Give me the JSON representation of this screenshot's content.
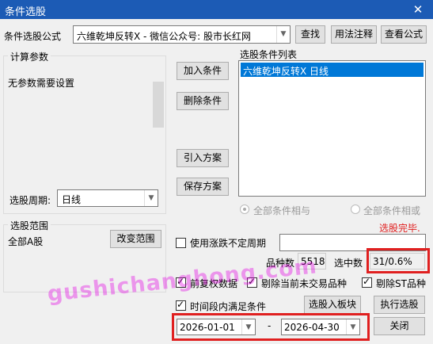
{
  "window": {
    "title": "条件选股",
    "close_glyph": "✕"
  },
  "formula": {
    "label": "条件选股公式",
    "value": "六维乾坤反转X  -  微信公众号: 股市长红网",
    "dropdown_glyph": "▼",
    "find_label": "查找",
    "usage_label": "用法注释",
    "view_label": "查看公式"
  },
  "params": {
    "legend": "计算参数",
    "text": "无参数需要设置"
  },
  "period": {
    "label": "选股周期:",
    "value": "日线",
    "dropdown_glyph": "▼"
  },
  "buttons": {
    "add": "加入条件",
    "delete": "删除条件",
    "import": "引入方案",
    "save": "保存方案",
    "change_range": "改变范围",
    "to_block": "选股入板块",
    "execute": "执行选股",
    "close": "关闭"
  },
  "conditions": {
    "label": "选股条件列表",
    "items": [
      "六维乾坤反转X  日线"
    ]
  },
  "logic": {
    "and_label": "全部条件相与",
    "or_label": "全部条件相或"
  },
  "status": "选股完毕.",
  "range": {
    "legend": "选股范围",
    "value": "全部A股"
  },
  "uncertain_period": {
    "label": "使用涨跌不定周期",
    "checked": false,
    "value": ""
  },
  "stats": {
    "count_label": "品种数",
    "count_value": "5518",
    "selected_label": "选中数",
    "selected_value": "31/0.6%"
  },
  "options": {
    "restore": {
      "label": "前复权数据",
      "checked": true
    },
    "exclude_untraded": {
      "label": "剔除当前未交易品种",
      "checked": true
    },
    "exclude_st": {
      "label": "剔除ST品种",
      "checked": true
    },
    "time_range": {
      "label": "时间段内满足条件",
      "checked": true
    }
  },
  "dates": {
    "start": "2026-01-01",
    "separator": "-",
    "end": "2026-04-30",
    "dropdown_glyph": "▼"
  },
  "watermark": "gushichanghong.com",
  "colors": {
    "titlebar": "#1c5bb5",
    "selection": "#0078d7",
    "status": "#e02020",
    "highlight": "#e02020"
  }
}
